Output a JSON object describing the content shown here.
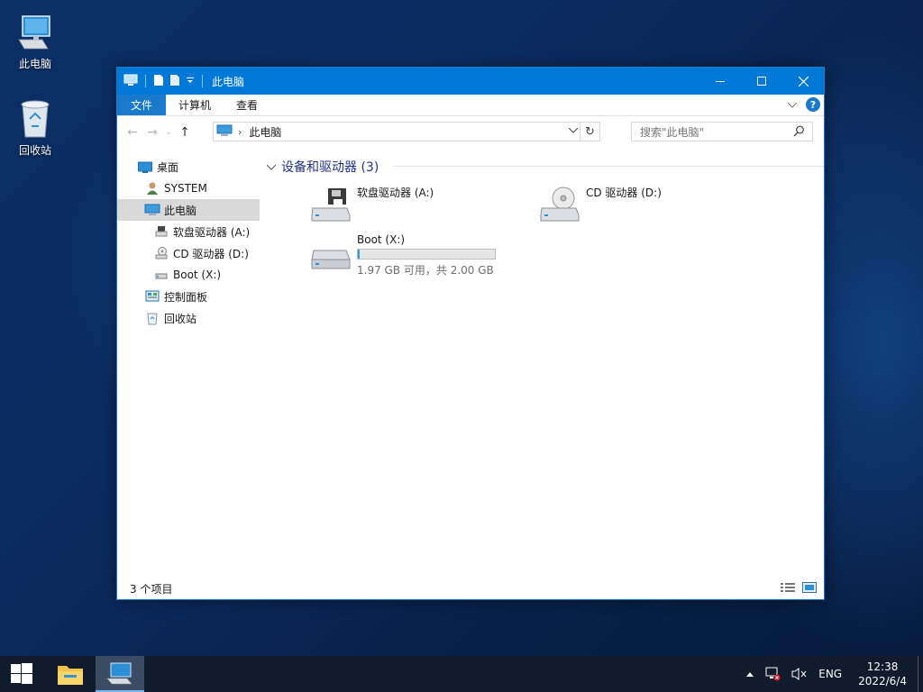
{
  "desktop": {
    "icons": [
      {
        "label": "此电脑",
        "icon": "computer-icon"
      },
      {
        "label": "回收站",
        "icon": "recycle-bin-icon"
      }
    ]
  },
  "window": {
    "title": "此电脑",
    "ribbon_tabs": [
      "文件",
      "计算机",
      "查看"
    ],
    "address": "此电脑",
    "search_placeholder": "搜索\"此电脑\"",
    "accent_color": "#0078d7"
  },
  "navpane": {
    "items": [
      {
        "label": "桌面",
        "icon": "desktop-icon"
      },
      {
        "label": "SYSTEM",
        "icon": "user-folder-icon"
      },
      {
        "label": "此电脑",
        "icon": "computer-icon",
        "selected": true
      },
      {
        "label": "软盘驱动器 (A:)",
        "icon": "floppy-drive-icon"
      },
      {
        "label": "CD 驱动器 (D:)",
        "icon": "cd-drive-icon"
      },
      {
        "label": "Boot (X:)",
        "icon": "drive-icon"
      },
      {
        "label": "控制面板",
        "icon": "control-panel-icon"
      },
      {
        "label": "回收站",
        "icon": "recycle-bin-icon"
      }
    ]
  },
  "content": {
    "group_title": "设备和驱动器 (3)",
    "drives": [
      {
        "name": "软盘驱动器 (A:)",
        "icon": "floppy-drive-icon"
      },
      {
        "name": "CD 驱动器 (D:)",
        "icon": "cd-drive-icon"
      },
      {
        "name": "Boot (X:)",
        "icon": "drive-icon",
        "usage_text": "1.97 GB 可用，共 2.00 GB",
        "used_fraction": 0.015
      }
    ]
  },
  "statusbar": {
    "item_count": "3 个项目"
  },
  "taskbar": {
    "tray_lang": "ENG",
    "time": "12:38",
    "date": "2022/6/4"
  }
}
